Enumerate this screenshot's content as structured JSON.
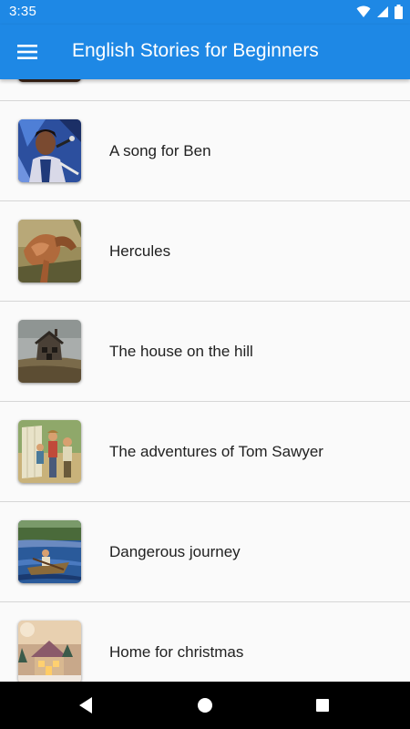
{
  "status_bar": {
    "time": "3:35",
    "icons": [
      "wifi-icon",
      "signal-icon",
      "battery-icon"
    ]
  },
  "app_bar": {
    "title": "English Stories for Beginners",
    "menu_icon": "hamburger-menu-icon",
    "background": "#1e88e5"
  },
  "stories": [
    {
      "title": "",
      "thumbnail": "story-thumbnail"
    },
    {
      "title": "A song for Ben",
      "thumbnail": "singer-thumbnail"
    },
    {
      "title": "Hercules",
      "thumbnail": "hercules-thumbnail"
    },
    {
      "title": "The house on the hill",
      "thumbnail": "house-thumbnail"
    },
    {
      "title": "The adventures of Tom Sawyer",
      "thumbnail": "tom-sawyer-thumbnail"
    },
    {
      "title": "Dangerous journey",
      "thumbnail": "boat-thumbnail"
    },
    {
      "title": "Home for christmas",
      "thumbnail": "christmas-house-thumbnail"
    }
  ],
  "nav_bar": {
    "back": "back-icon",
    "home": "home-icon",
    "recents": "recents-icon"
  }
}
